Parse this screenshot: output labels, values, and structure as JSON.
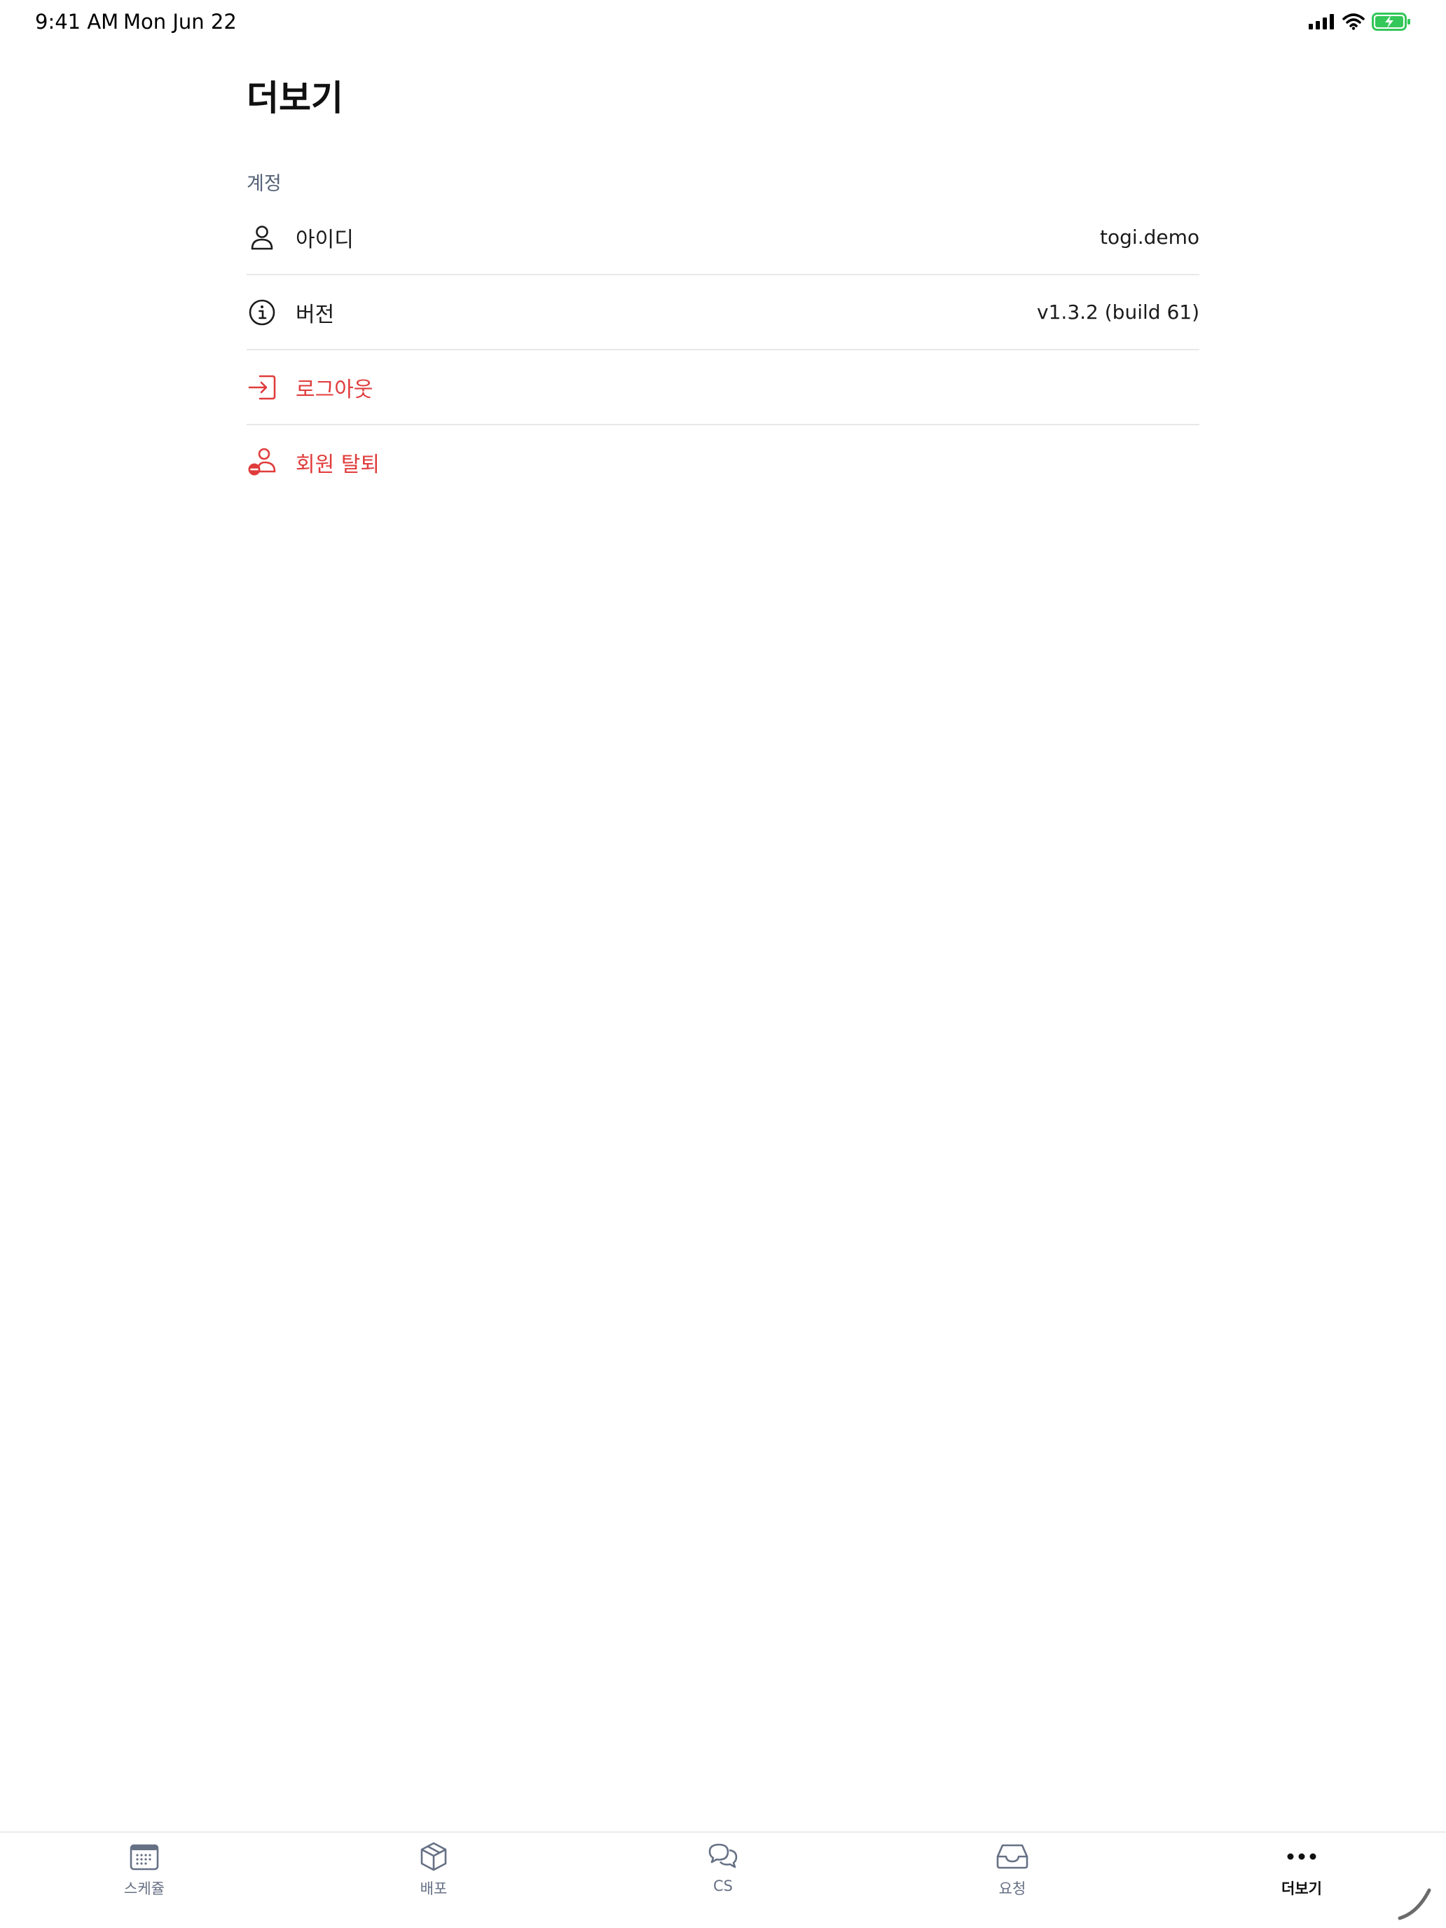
{
  "status_bar": {
    "time": "9:41 AM",
    "date": "Mon Jun 22"
  },
  "page": {
    "title": "더보기"
  },
  "account_section": {
    "label": "계정",
    "rows": [
      {
        "label": "아이디",
        "value": "togi.demo",
        "icon": "user-icon"
      },
      {
        "label": "버전",
        "value": "v1.3.2 (build 61)",
        "icon": "info-icon"
      },
      {
        "label": "로그아웃",
        "icon": "logout-icon"
      },
      {
        "label": "회원 탈퇴",
        "icon": "user-remove-icon"
      }
    ]
  },
  "tab_bar": {
    "tabs": [
      {
        "label": "스케쥴",
        "icon": "calendar-icon"
      },
      {
        "label": "배포",
        "icon": "box-icon"
      },
      {
        "label": "CS",
        "icon": "chat-bubbles-icon"
      },
      {
        "label": "요청",
        "icon": "inbox-icon"
      },
      {
        "label": "더보기",
        "icon": "more-dots-icon"
      }
    ],
    "active_index": 4
  },
  "colors": {
    "danger": "#e03c3c",
    "section_label": "#556377",
    "inactive_tab": "#667085",
    "battery": "#34c759"
  }
}
